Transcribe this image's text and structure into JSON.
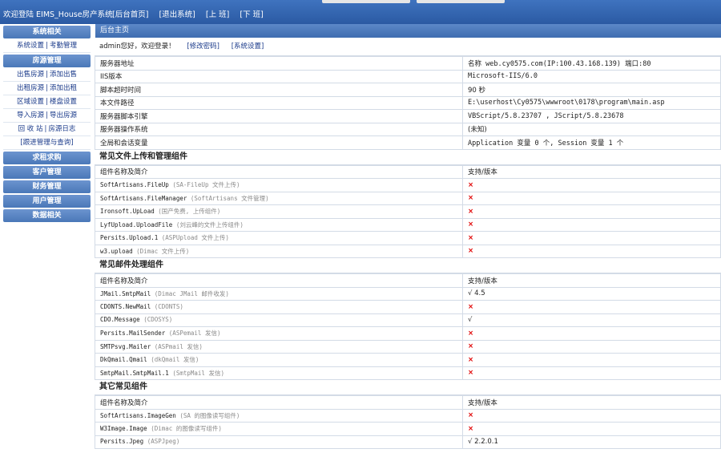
{
  "topbar": {
    "welcome": "欢迎登陆 EIMS_House房产系统",
    "links": [
      "[后台首页]",
      "[退出系统]",
      "[上 班]",
      "[下 班]"
    ]
  },
  "sidebar": {
    "sections": [
      {
        "title": "系统相关",
        "items": [
          [
            "系统设置",
            "考勤管理"
          ]
        ]
      },
      {
        "title": "房源管理",
        "items": [
          [
            "出售房源",
            "添加出售"
          ],
          [
            "出租房源",
            "添加出租"
          ],
          [
            "区域设置",
            "楼盘设置"
          ],
          [
            "导入房源",
            "导出房源"
          ],
          [
            "回 收 站",
            "房源日志"
          ],
          [
            "[跟进管理与查询]"
          ]
        ]
      },
      {
        "title": "求租求购",
        "items": []
      },
      {
        "title": "客户管理",
        "items": []
      },
      {
        "title": "财务管理",
        "items": []
      },
      {
        "title": "用户管理",
        "items": []
      },
      {
        "title": "数据相关",
        "items": []
      }
    ]
  },
  "main": {
    "header": "后台主页",
    "admin_text": "admin您好，欢迎登录！",
    "admin_links": [
      "[修改密码]",
      "[系统设置]"
    ],
    "server_info": [
      {
        "label": "服务器地址",
        "value": "名称 web.cy0575.com(IP:100.43.168.139) 端口:80"
      },
      {
        "label": "IIS版本",
        "value": "Microsoft-IIS/6.0"
      },
      {
        "label": "脚本超时时间",
        "value": "90 秒"
      },
      {
        "label": "本文件路径",
        "value": "E:\\userhost\\Cy0575\\wwwroot\\0178\\program\\main.asp"
      },
      {
        "label": "服务器脚本引擎",
        "value": "VBScript/5.8.23707 , JScript/5.8.23678"
      },
      {
        "label": "服务器操作系统",
        "value": "(未知)"
      },
      {
        "label": "全局和会话变量",
        "value": "Application 变量 0 个, Session 变量 1 个"
      }
    ],
    "sections": [
      {
        "title": "常见文件上传和管理组件",
        "col1": "组件名称及简介",
        "col2": "支持/版本",
        "rows": [
          {
            "name": "SoftArtisans.FileUp",
            "desc": "(SA-FileUp 文件上传)",
            "support": "×"
          },
          {
            "name": "SoftArtisans.FileManager",
            "desc": "(SoftArtisans 文件管理)",
            "support": "×"
          },
          {
            "name": "Ironsoft.UpLoad",
            "desc": "(国产免费, 上传组件)",
            "support": "×"
          },
          {
            "name": "LyfUpload.UploadFile",
            "desc": "(刘云峰的文件上传组件)",
            "support": "×"
          },
          {
            "name": "Persits.Upload.1",
            "desc": "(ASPUpload 文件上传)",
            "support": "×"
          },
          {
            "name": "w3.upload",
            "desc": "(Dimac 文件上传)",
            "support": "×"
          }
        ]
      },
      {
        "title": "常见邮件处理组件",
        "col1": "组件名称及简介",
        "col2": "支持/版本",
        "rows": [
          {
            "name": "JMail.SmtpMail",
            "desc": "(Dimac JMail 邮件收发)",
            "support": "√ 4.5"
          },
          {
            "name": "CDONTS.NewMail",
            "desc": "(CDONTS)",
            "support": "×"
          },
          {
            "name": "CDO.Message",
            "desc": "(CDOSYS)",
            "support": "√"
          },
          {
            "name": "Persits.MailSender",
            "desc": "(ASPemail 发信)",
            "support": "×"
          },
          {
            "name": "SMTPsvg.Mailer",
            "desc": "(ASPmail 发信)",
            "support": "×"
          },
          {
            "name": "DkQmail.Qmail",
            "desc": "(dkQmail 发信)",
            "support": "×"
          },
          {
            "name": "SmtpMail.SmtpMail.1",
            "desc": "(SmtpMail 发信)",
            "support": "×"
          }
        ]
      },
      {
        "title": "其它常见组件",
        "col1": "组件名称及简介",
        "col2": "支持/版本",
        "rows": [
          {
            "name": "SoftArtisans.ImageGen",
            "desc": "(SA 的图像读写组件)",
            "support": "×"
          },
          {
            "name": "W3Image.Image",
            "desc": "(Dimac 的图像读写组件)",
            "support": "×"
          },
          {
            "name": "Persits.Jpeg",
            "desc": "(ASPJpeg)",
            "support": "√ 2.2.0.1"
          }
        ]
      }
    ]
  }
}
